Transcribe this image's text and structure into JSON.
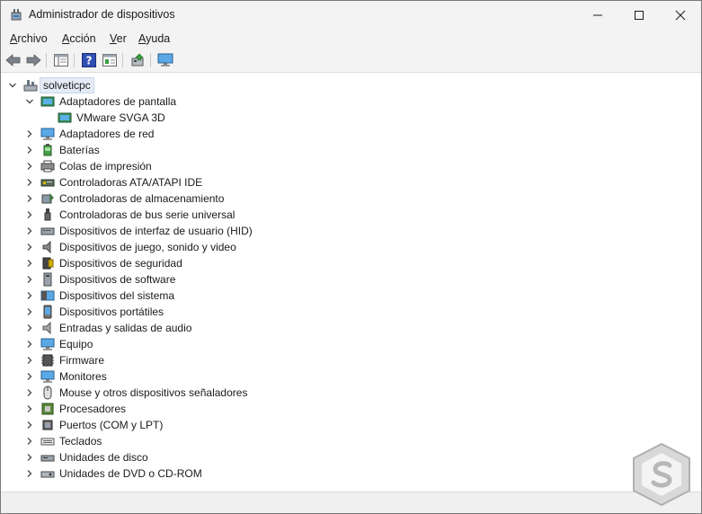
{
  "window": {
    "title": "Administrador de dispositivos"
  },
  "menu": [
    {
      "label_u": "A",
      "label_rest": "rchivo"
    },
    {
      "label_u": "A",
      "label_rest": "cción"
    },
    {
      "label_u": "V",
      "label_rest": "er"
    },
    {
      "label_u": "A",
      "label_rest": "yuda"
    }
  ],
  "tree": {
    "root": "solveticpc",
    "display_adapters": "Adaptadores de pantalla",
    "vmware": "VMware SVGA 3D",
    "categories": [
      "Adaptadores de red",
      "Baterías",
      "Colas de impresión",
      "Controladoras ATA/ATAPI IDE",
      "Controladoras de almacenamiento",
      "Controladoras de bus serie universal",
      "Dispositivos de interfaz de usuario (HID)",
      "Dispositivos de juego, sonido y video",
      "Dispositivos de seguridad",
      "Dispositivos de software",
      "Dispositivos del sistema",
      "Dispositivos portátiles",
      "Entradas y salidas de audio",
      "Equipo",
      "Firmware",
      "Monitores",
      "Mouse y otros dispositivos señaladores",
      "Procesadores",
      "Puertos (COM y LPT)",
      "Teclados",
      "Unidades de disco",
      "Unidades de DVD o CD-ROM"
    ]
  },
  "colors": {
    "accent": "#1a73d8",
    "selection": "#e5ebf5",
    "chrome": "#f3f3f3"
  }
}
